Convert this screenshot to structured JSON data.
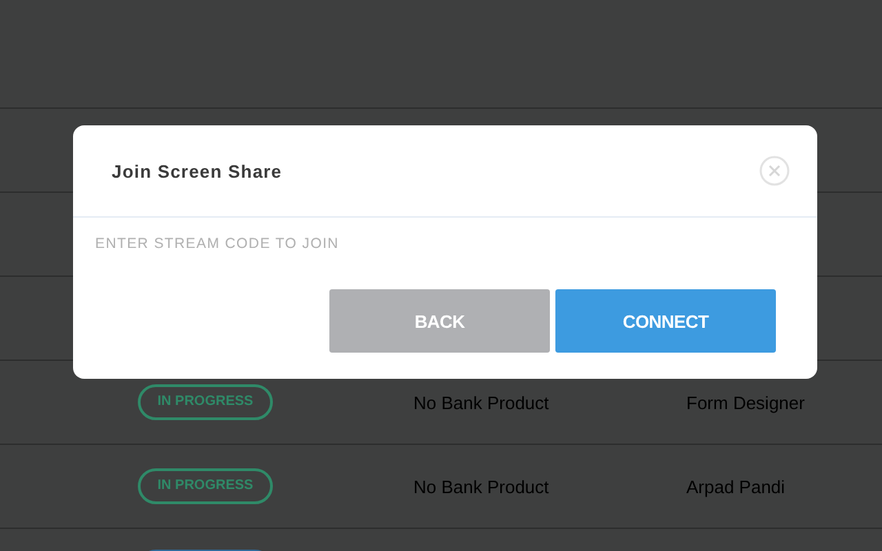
{
  "table": {
    "rows": [
      {
        "status": {
          "label": "IN PROGRESS",
          "color": "#2f8a68"
        },
        "product": "No Bank Product",
        "owner": "Form Designer"
      },
      {
        "status": {
          "label": "IN PROGRESS",
          "color": "#2f8a68"
        },
        "product": "No Bank Product",
        "owner": "Arpad Pandi"
      },
      {
        "status": {
          "color": "#2f6a9a"
        }
      }
    ]
  },
  "dialog": {
    "title": "Join Screen Share",
    "stream_code": {
      "placeholder": "ENTER STREAM CODE TO JOIN"
    },
    "buttons": [
      {
        "label": "BACK",
        "kind": "secondary"
      },
      {
        "label": "CONNECT",
        "kind": "primary"
      }
    ]
  }
}
